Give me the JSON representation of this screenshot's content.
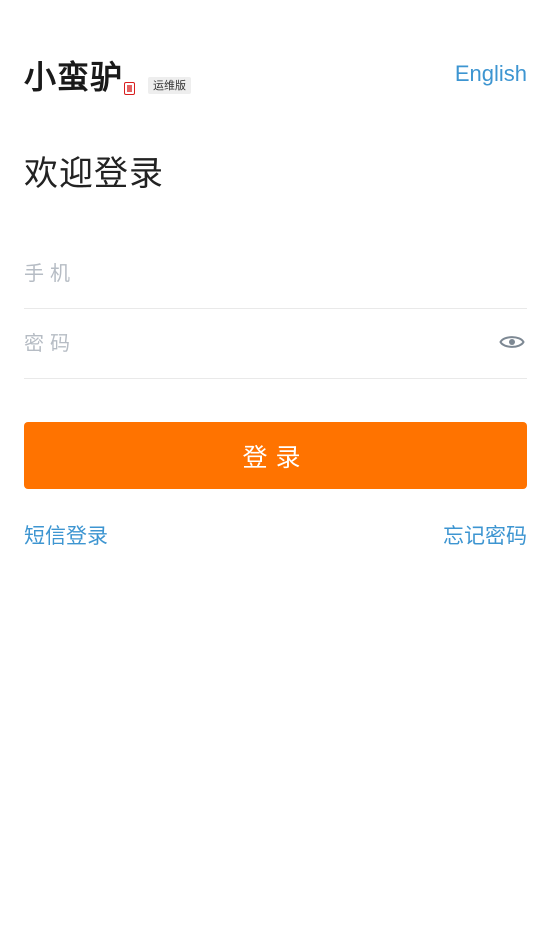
{
  "header": {
    "logo_text": "小蛮驴",
    "edition_badge": "运维版",
    "language_link": "English"
  },
  "main": {
    "welcome_title": "欢迎登录",
    "phone_field": {
      "placeholder": "手机",
      "value": ""
    },
    "password_field": {
      "placeholder": "密码",
      "value": "",
      "toggle_icon": "eye-icon"
    },
    "login_button": "登录",
    "sms_login_link": "短信登录",
    "forgot_password_link": "忘记密码"
  },
  "colors": {
    "accent": "#ff7300",
    "link": "#3d95d1",
    "placeholder": "#b6bcc4"
  }
}
